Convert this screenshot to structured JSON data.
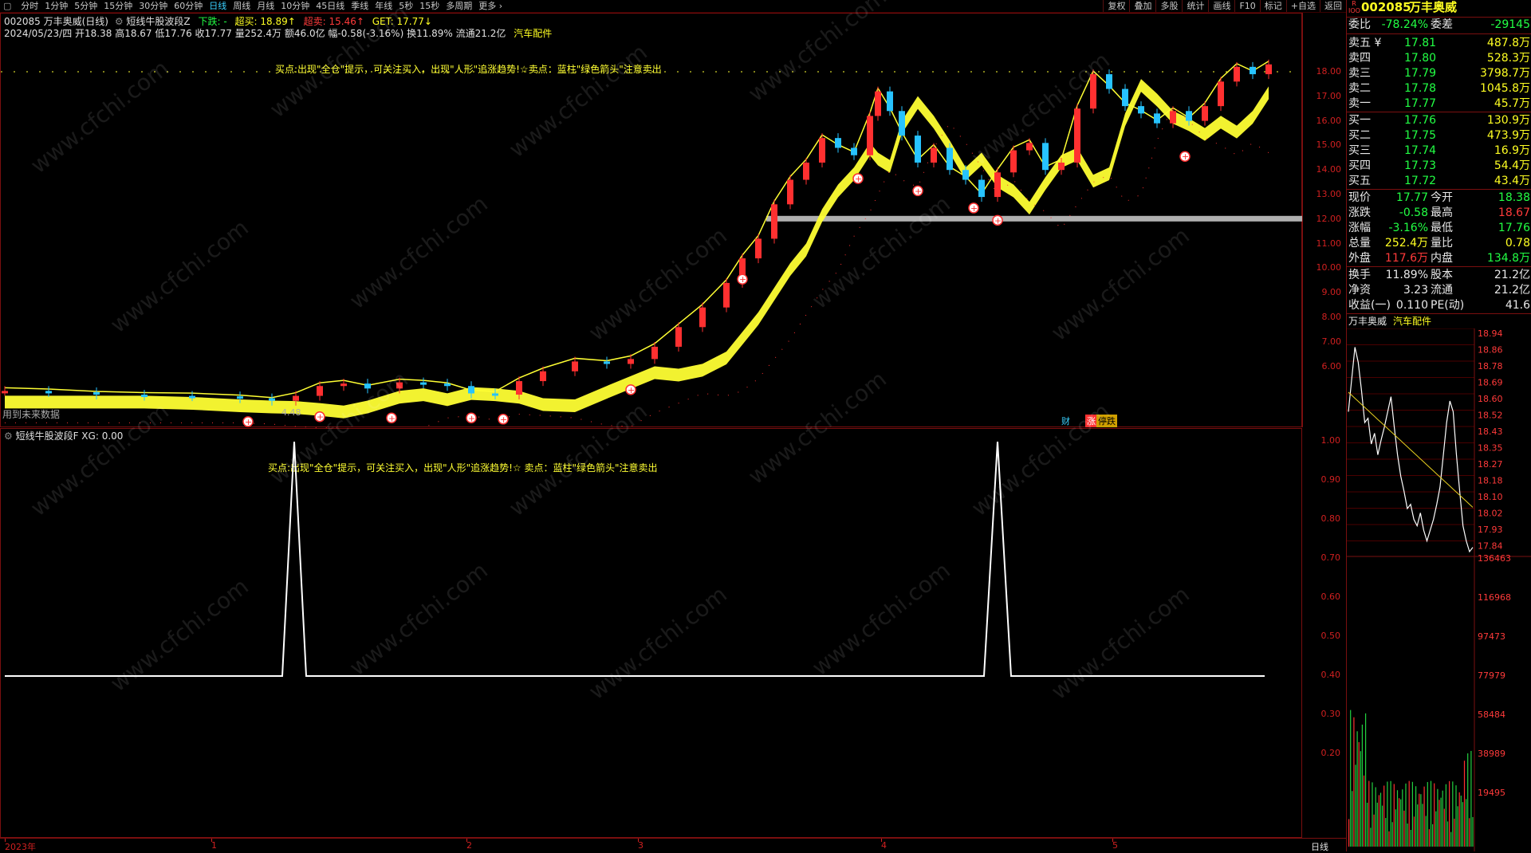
{
  "tabs": [
    "分时",
    "1分钟",
    "5分钟",
    "15分钟",
    "30分钟",
    "60分钟",
    "日线",
    "周线",
    "月线",
    "10分钟",
    "45日线",
    "季线",
    "年线",
    "5秒",
    "15秒",
    "多周期",
    "更多 ›"
  ],
  "active_tab": "日线",
  "toolbar_right": [
    "复权",
    "叠加",
    "多股",
    "统计",
    "画线",
    "F10",
    "标记",
    "+自选",
    "返回"
  ],
  "header": {
    "title_line": "002085 万丰奥威(日线)",
    "indicator_name": "短线牛股波段Z",
    "ind_down": "下跌: -",
    "ind_overbuy": "超买: 18.89↑",
    "ind_oversell": "超卖: 15.46↑",
    "ind_get": "GET: 17.77↓",
    "info_line": "2024/05/23/四 开18.38 高18.67 低17.76 收17.77 量252.4万 额46.0亿 幅-0.58(-3.16%) 换11.89% 流通21.2亿",
    "sector": "汽车配件"
  },
  "main_note": "买点:出现\"全仓\"提示，可关注买入，出现\"人形\"追涨趋势!☆卖点：蓝柱\"绿色箭头\"注意卖出",
  "main_y_ticks": [
    "18.00",
    "17.00",
    "16.00",
    "15.00",
    "14.00",
    "13.00",
    "12.00",
    "11.00",
    "10.00",
    "9.00",
    "8.00",
    "7.00",
    "6.00"
  ],
  "main_bottom_labels": {
    "left": "用到未来数据",
    "num": "4.48",
    "cai": "财",
    "zhangting": "涨",
    "tingban": "停跌"
  },
  "sub_title": "短线牛股波段F XG: 0.00",
  "sub_note": "买点:出现\"全仓\"提示，可关注买入，出现\"人形\"追涨趋势!☆   卖点：蓝柱\"绿色箭头\"注意卖出",
  "sub_y_ticks": [
    "1.00",
    "0.90",
    "0.80",
    "0.70",
    "0.60",
    "0.50",
    "0.40",
    "0.30",
    "0.20"
  ],
  "time_labels": [
    "2023年",
    "1",
    "2",
    "3",
    "4",
    "5"
  ],
  "time_unit": "日线",
  "right": {
    "code": "002085",
    "name": "万丰奥威",
    "corner": "R\nIOO",
    "weibi_label": "委比",
    "weibi": "-78.24%",
    "weicha_label": "委差",
    "weicha": "-29145",
    "asks": [
      {
        "label": "卖五 ¥",
        "price": "17.81",
        "vol": "487.8万"
      },
      {
        "label": "卖四",
        "price": "17.80",
        "vol": "528.3万"
      },
      {
        "label": "卖三",
        "price": "17.79",
        "vol": "3798.7万"
      },
      {
        "label": "卖二",
        "price": "17.78",
        "vol": "1045.8万"
      },
      {
        "label": "卖一",
        "price": "17.77",
        "vol": "45.7万"
      }
    ],
    "bids": [
      {
        "label": "买一",
        "price": "17.76",
        "vol": "130.9万"
      },
      {
        "label": "买二",
        "price": "17.75",
        "vol": "473.9万"
      },
      {
        "label": "买三",
        "price": "17.74",
        "vol": "16.9万"
      },
      {
        "label": "买四",
        "price": "17.73",
        "vol": "54.4万"
      },
      {
        "label": "买五",
        "price": "17.72",
        "vol": "43.4万"
      }
    ],
    "stats": [
      {
        "l1": "现价",
        "v1": "17.77",
        "l2": "今开",
        "v2": "18.38"
      },
      {
        "l1": "涨跌",
        "v1": "-0.58",
        "l2": "最高",
        "v2": "18.67"
      },
      {
        "l1": "涨幅",
        "v1": "-3.16%",
        "l2": "最低",
        "v2": "17.76"
      },
      {
        "l1": "总量",
        "v1": "252.4万",
        "l2": "量比",
        "v2": "0.78"
      },
      {
        "l1": "外盘",
        "v1": "117.6万",
        "l2": "内盘",
        "v2": "134.8万"
      }
    ],
    "fund": [
      {
        "l1": "换手",
        "v1": "11.89%",
        "l2": "股本",
        "v2": "21.2亿"
      },
      {
        "l1": "净资",
        "v1": "3.23",
        "l2": "流通",
        "v2": "21.2亿"
      },
      {
        "l1": "收益(一)",
        "v1": "0.110",
        "l2": "PE(动)",
        "v2": "41.6"
      }
    ],
    "mini_name": "万丰奥威",
    "mini_sector": "汽车配件",
    "mini_price_ticks": [
      "18.94",
      "18.86",
      "18.78",
      "18.69",
      "18.60",
      "18.52",
      "18.43",
      "18.35",
      "18.27",
      "18.18",
      "18.10",
      "18.02",
      "17.93",
      "17.84"
    ],
    "mini_vol_ticks": [
      "136463",
      "116968",
      "97473",
      "77979",
      "58484",
      "38989",
      "19495"
    ]
  },
  "watermark": "www.cfchi.com",
  "colors": {
    "up": "#ff3030",
    "down": "#27c3ff",
    "ribbon": "#ffff33",
    "zigzag": "#ffff33",
    "frame": "#7a0f0f",
    "axis": "#d02020"
  }
}
